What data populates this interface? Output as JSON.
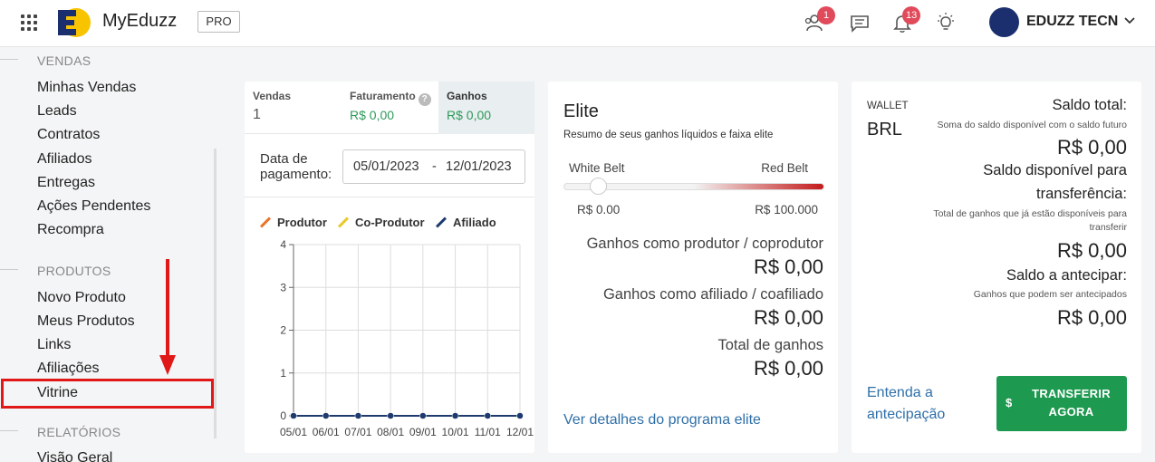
{
  "header": {
    "brand": "MyEduzz",
    "plan_badge": "PRO",
    "notifications": [
      {
        "icon": "users-icon",
        "count": "1"
      },
      {
        "icon": "chat-icon",
        "count": ""
      },
      {
        "icon": "bell-icon",
        "count": "13"
      },
      {
        "icon": "lightbulb-icon",
        "count": ""
      }
    ],
    "user_name": "EDUZZ TECN"
  },
  "sidebar": {
    "sections": [
      {
        "title": "VENDAS",
        "items": [
          "Minhas Vendas",
          "Leads",
          "Contratos",
          "Afiliados",
          "Entregas",
          "Ações Pendentes",
          "Recompra"
        ]
      },
      {
        "title": "PRODUTOS",
        "items": [
          "Novo Produto",
          "Meus Produtos",
          "Links",
          "Afiliações",
          "Vitrine"
        ]
      },
      {
        "title": "RELATÓRIOS",
        "items": [
          "Visão Geral"
        ]
      }
    ],
    "highlighted_item": "Vitrine"
  },
  "summary": {
    "tabs": [
      {
        "label": "Vendas",
        "value": "1",
        "has_help": false,
        "active": false
      },
      {
        "label": "Faturamento",
        "value": "R$ 0,00",
        "has_help": true,
        "active": false
      },
      {
        "label": "Ganhos",
        "value": "R$ 0,00",
        "has_help": false,
        "active": true
      }
    ],
    "date_label": "Data de pagamento:",
    "date_start": "05/01/2023",
    "date_separator": "-",
    "date_end": "12/01/2023"
  },
  "chart_data": {
    "type": "line",
    "categories": [
      "05/01",
      "06/01",
      "07/01",
      "08/01",
      "09/01",
      "10/01",
      "11/01",
      "12/01"
    ],
    "series": [
      {
        "name": "Produtor",
        "color": "#e8742a",
        "values": [
          0,
          0,
          0,
          0,
          0,
          0,
          0,
          0
        ]
      },
      {
        "name": "Co-Produtor",
        "color": "#e8c82a",
        "values": [
          0,
          0,
          0,
          0,
          0,
          0,
          0,
          0
        ]
      },
      {
        "name": "Afiliado",
        "color": "#1f3a6e",
        "values": [
          0,
          0,
          0,
          0,
          0,
          0,
          0,
          0
        ]
      }
    ],
    "ylim": [
      0,
      4
    ],
    "yticks": [
      0,
      1,
      2,
      3,
      4
    ],
    "grid": true,
    "legend": "top-left"
  },
  "elite": {
    "title": "Elite",
    "subtitle": "Resumo de seus ganhos líquidos e faixa elite",
    "belt_start": "White Belt",
    "belt_end": "Red Belt",
    "belt_progress": 0,
    "belt_min": "R$ 0.00",
    "belt_max": "R$ 100.000",
    "rows": [
      {
        "label": "Ganhos como produtor / coprodutor",
        "value": "R$ 0,00"
      },
      {
        "label": "Ganhos como afiliado / coafiliado",
        "value": "R$ 0,00"
      },
      {
        "label": "Total de ganhos",
        "value": "R$ 0,00"
      }
    ],
    "link": "Ver detalhes do programa elite"
  },
  "wallet": {
    "label": "WALLET",
    "currency": "BRL",
    "total_label": "Saldo total:",
    "total_desc": "Soma do saldo disponível com o saldo futuro",
    "total_value": "R$ 0,00",
    "available_label_1": "Saldo disponível para",
    "available_label_2": "transferência:",
    "available_desc_1": "Total de ganhos que já estão disponíveis para",
    "available_desc_2": "transferir",
    "available_value": "R$ 0,00",
    "advance_label": "Saldo a antecipar:",
    "advance_desc": "Ganhos que podem ser antecipados",
    "advance_value": "R$ 0,00",
    "advance_link": "Entenda a antecipação",
    "transfer_symbol": "$",
    "transfer_button": "TRANSFERIR AGORA"
  },
  "colors": {
    "accent_green": "#1e9a50",
    "link_blue": "#2e6fa8",
    "highlight_red": "#e01818",
    "badge_red": "#e04a5a",
    "positive_green": "#2e9a5a"
  }
}
